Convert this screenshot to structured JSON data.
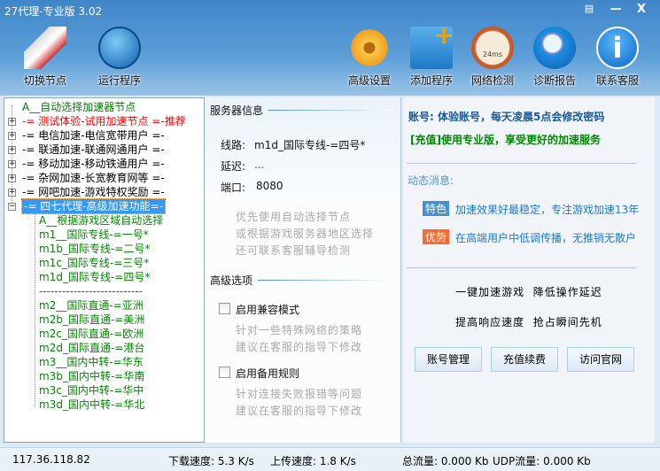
{
  "window": {
    "title": "27代理-专业版 3.02",
    "controls": [
      "▤",
      "—",
      "X"
    ]
  },
  "toolbar": {
    "left": [
      {
        "label": "切换节点",
        "icon": "rocket-icon"
      },
      {
        "label": "运行程序",
        "icon": "globe-icon"
      }
    ],
    "right": [
      {
        "label": "高级设置",
        "icon": "gear-icon"
      },
      {
        "label": "添加程序",
        "icon": "folder-add-icon"
      },
      {
        "label": "网络检测",
        "icon": "speedometer-icon",
        "icon_text": "24ms"
      },
      {
        "label": "诊断报告",
        "icon": "magnifier-icon"
      },
      {
        "label": "联系客服",
        "icon": "info-icon"
      }
    ]
  },
  "tree": {
    "top": [
      {
        "text": "A__自动选择加速器节点",
        "color": "#008000",
        "expander": false
      },
      {
        "text": "-= 测试体验-试用加速节点 =-推荐",
        "color": "#ff0000",
        "expander": true
      },
      {
        "text": "-= 电信加速-电信宽带用户 =-",
        "color": "#000000",
        "expander": true
      },
      {
        "text": "-= 联通加速-联通网通用户 =-",
        "color": "#000000",
        "expander": true
      },
      {
        "text": "-= 移动加速-移动铁通用户 =-",
        "color": "#000000",
        "expander": true
      },
      {
        "text": "-= 杂网加速-长宽教育网等 =-",
        "color": "#000000",
        "expander": true
      },
      {
        "text": "-= 网吧加速-游戏特权奖励 =-",
        "color": "#000000",
        "expander": true
      },
      {
        "text": "-= 四七代理-高级加速功能=-",
        "color": "#ffffff",
        "expander": true,
        "selected": true
      }
    ],
    "children": [
      "A__根据游戏区域自动选择",
      "m1__国际专线-=一号*",
      "m1b_国际专线-=二号*",
      "m1c_国际专线-=三号*",
      "m1d_国际专线-=四号*",
      "---------------------------",
      "m2__国际直通-=亚洲",
      "m2b_国际直通-=美洲",
      "m2c_国际直通-=欧洲",
      "m2d_国际直通-=港台",
      "m3__国内中转-=华东",
      "m3b_国内中转-=华南",
      "m3c_国内中转-=华中",
      "m3d_国内中转-=华北"
    ]
  },
  "server": {
    "heading": "服务器信息",
    "line_label": "线路:",
    "line_value": "m1d_国际专线-=四号*",
    "latency_label": "延迟:",
    "latency_value": "...",
    "port_label": "端口:",
    "port_value": "8080",
    "hint": [
      "优先使用自动选择节点",
      "或根据游戏服务器地区选择",
      "还可联系客服辅导检测"
    ]
  },
  "advanced": {
    "heading": "高级选项",
    "options": [
      {
        "label": "启用兼容模式",
        "checked": false,
        "desc": [
          "针对一些特殊网络的策略",
          "建议在客服的指导下修改"
        ]
      },
      {
        "label": "启用备用规则",
        "checked": false,
        "desc": [
          "针对连接失败报错等问题",
          "建议在客服的指导下修改"
        ]
      }
    ]
  },
  "account": {
    "account_line": "账号: 体验账号，每天凌晨5点会修改密码",
    "recharge_line": "[充值]使用专业版，享受更好的加速服务",
    "news_heading": "动态消息:",
    "news": [
      {
        "badge": "特色",
        "badge_color": "#4a8fd0",
        "text": "加速效果好最稳定，专注游戏加速13年"
      },
      {
        "badge": "优势",
        "badge_color": "#ff6a2a",
        "text": "在高端用户中低调传播，无推销无散户"
      }
    ],
    "slogan1": "一键加速游戏  降低操作延迟",
    "slogan2": "提高响应速度  抢占瞬间先机",
    "buttons": [
      "账号管理",
      "充值续费",
      "访问官网"
    ]
  },
  "status": {
    "ip": "117.36.118.82",
    "download": "下载速度: 5.3 K/s",
    "upload": "上传速度: 1.8 K/s",
    "total": "总流量: 0.000 Kb",
    "udp": "UDP流量: 0.000 Kb"
  }
}
